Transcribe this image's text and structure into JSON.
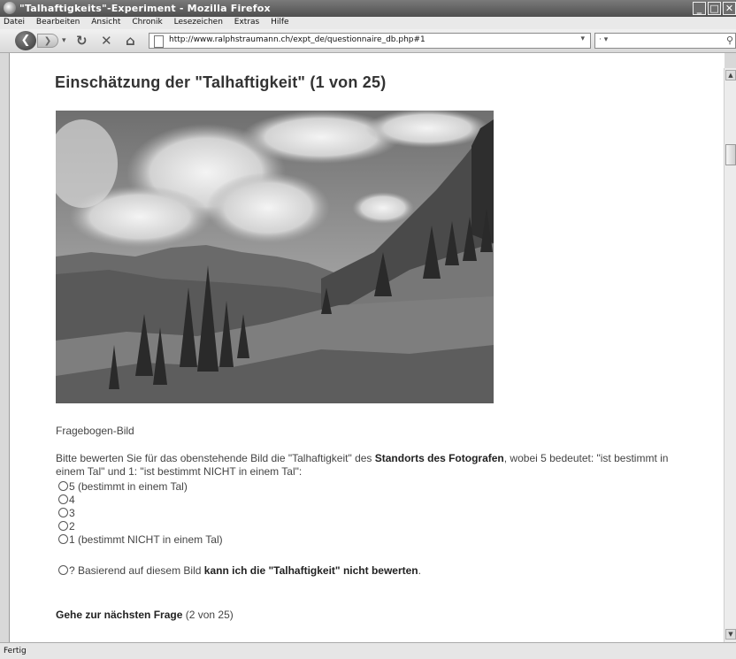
{
  "window": {
    "title": "\"Talhaftigkeits\"-Experiment - Mozilla Firefox"
  },
  "menu": [
    "Datei",
    "Bearbeiten",
    "Ansicht",
    "Chronik",
    "Lesezeichen",
    "Extras",
    "Hilfe"
  ],
  "nav": {
    "url": "http://www.ralphstraumann.ch/expt_de/questionnaire_db.php#1"
  },
  "status": "Fertig",
  "page": {
    "heading": "Einschätzung der \"Talhaftigkeit\" (1 von 25)",
    "caption": "Fragebogen-Bild",
    "q_pre": "Bitte bewerten Sie für das obenstehende Bild die \"Talhaftigkeit\" des ",
    "q_bold": "Standorts des Fotografen",
    "q_post": ", wobei 5 bedeutet: \"ist bestimmt in einem Tal\" und 1: \"ist bestimmt NICHT in einem Tal\":",
    "options": [
      "5 (bestimmt in einem Tal)",
      "4",
      "3",
      "2",
      "1 (bestimmt NICHT in einem Tal)"
    ],
    "unsure_pre": "? Basierend auf diesem Bild ",
    "unsure_bold": "kann ich die \"Talhaftigkeit\" nicht bewerten",
    "unsure_post": ".",
    "next_bold": "Gehe zur nächsten Frage",
    "next_rest": " (2 von 25)"
  }
}
